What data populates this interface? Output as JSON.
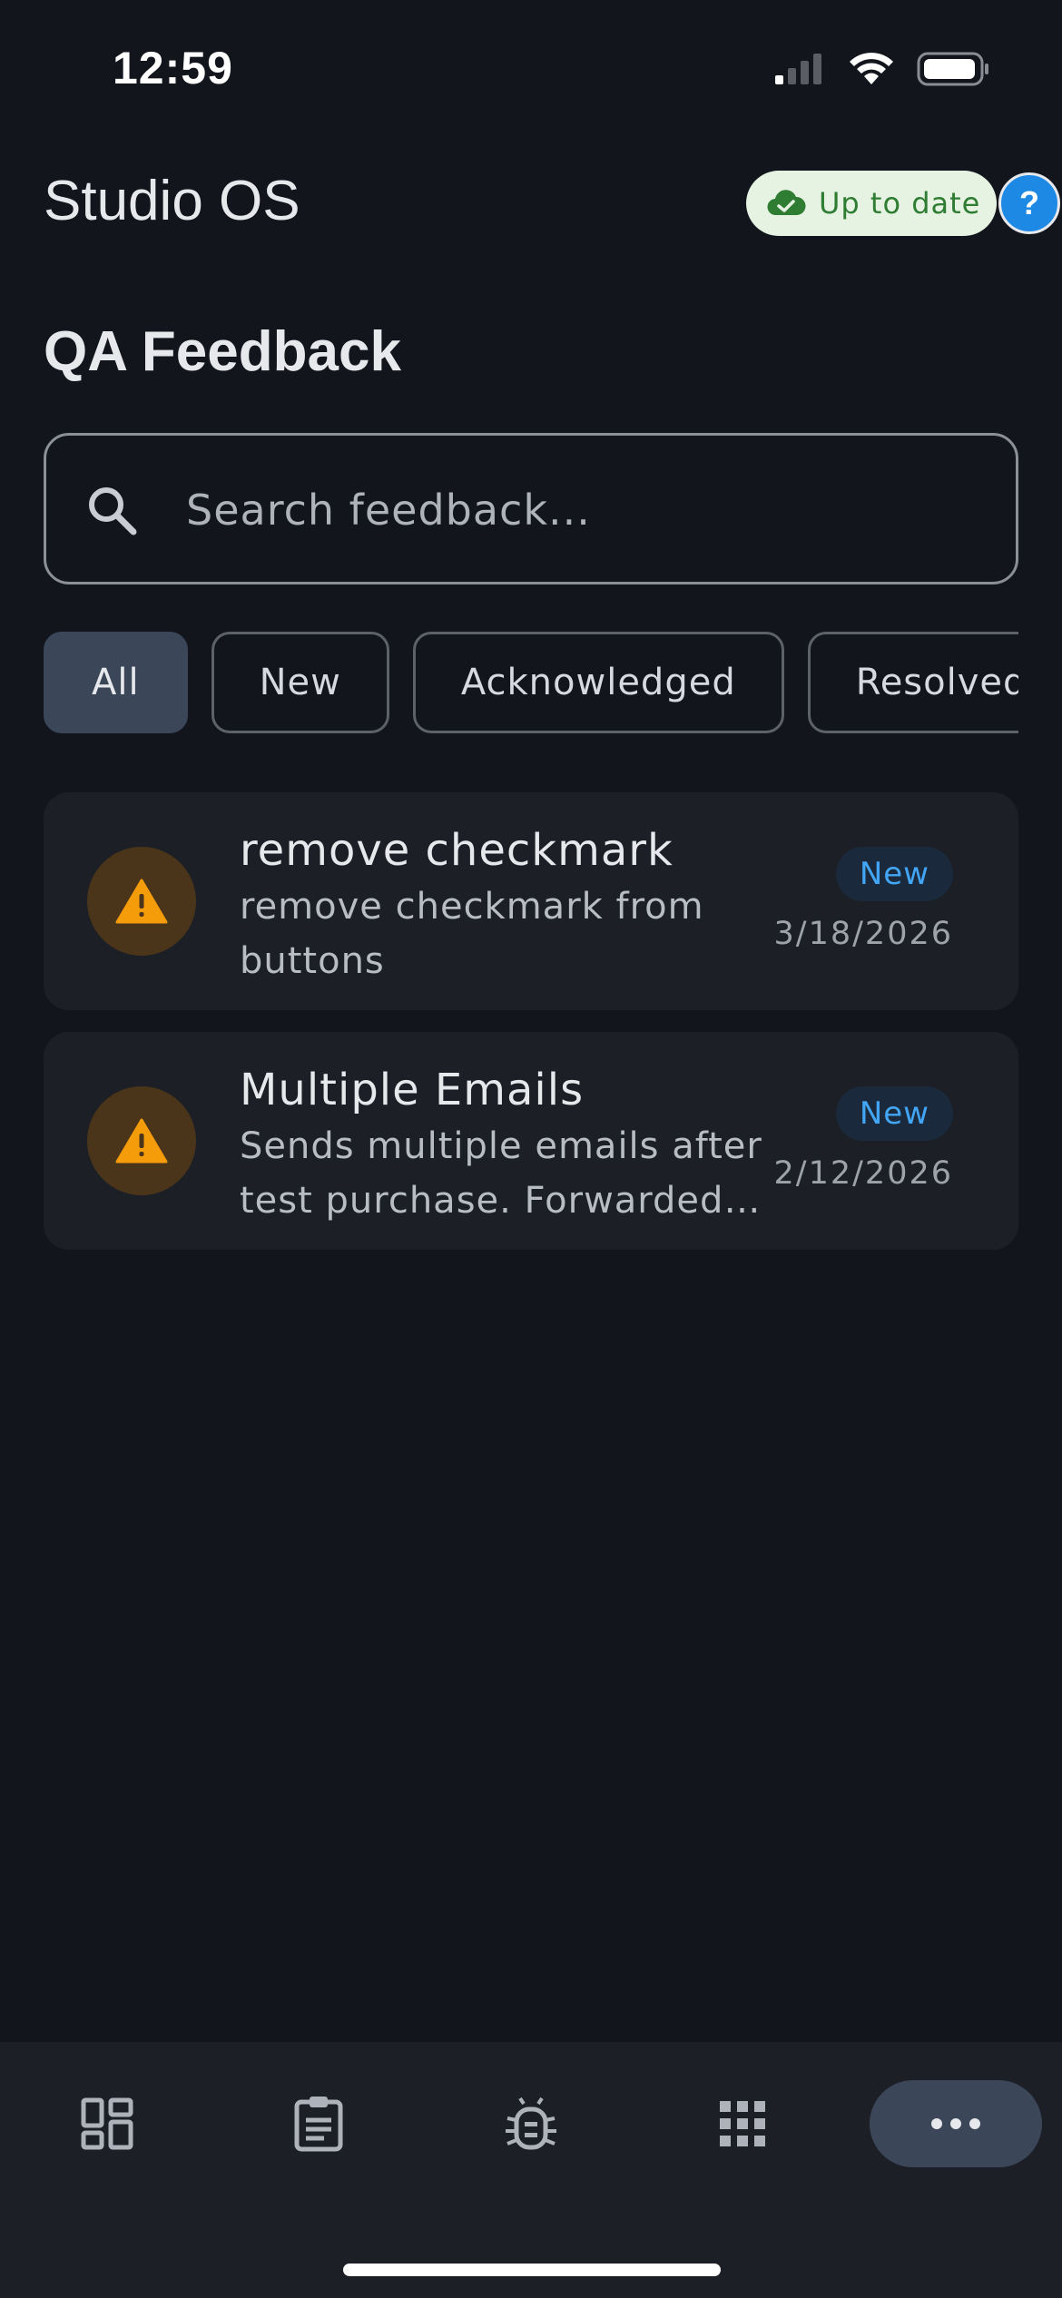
{
  "status_bar": {
    "time": "12:59"
  },
  "header": {
    "app_title": "Studio OS",
    "sync_status": "Up to date",
    "help_label": "?"
  },
  "page": {
    "title": "QA Feedback"
  },
  "search": {
    "placeholder": "Search feedback...",
    "value": ""
  },
  "filters": [
    {
      "label": "All",
      "active": true
    },
    {
      "label": "New",
      "active": false
    },
    {
      "label": "Acknowledged",
      "active": false
    },
    {
      "label": "Resolved",
      "active": false
    }
  ],
  "feedback_items": [
    {
      "title": "remove checkmark",
      "description": "remove checkmark from buttons",
      "status": "New",
      "date": "3/18/2026",
      "icon": "warning-icon"
    },
    {
      "title": "Multiple Emails",
      "description": "Sends multiple emails after test purchase. Forwarded to dev team for review.",
      "status": "New",
      "date": "2/12/2026",
      "icon": "warning-icon"
    }
  ],
  "bottom_nav": [
    {
      "name": "dashboard",
      "icon": "dashboard-icon"
    },
    {
      "name": "clipboard",
      "icon": "clipboard-icon"
    },
    {
      "name": "bug",
      "icon": "bug-icon"
    },
    {
      "name": "apps",
      "icon": "apps-grid-icon"
    },
    {
      "name": "more",
      "icon": "more-horizontal-icon",
      "active": true
    }
  ],
  "colors": {
    "background": "#12151b",
    "card": "#1c1f25",
    "accent_blue": "#1e88e5",
    "warning": "#f59c0b",
    "success": "#2e7d32"
  }
}
